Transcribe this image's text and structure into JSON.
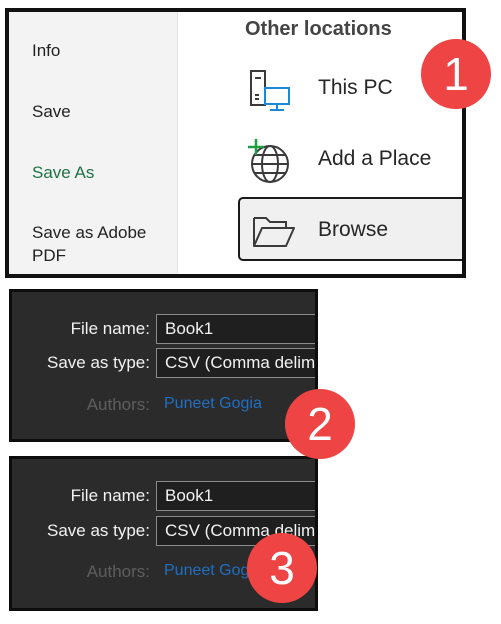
{
  "backstage": {
    "nav": [
      {
        "label": "Info",
        "active": false
      },
      {
        "label": "Save",
        "active": false
      },
      {
        "label": "Save As",
        "active": true
      },
      {
        "label": "Save as Adobe PDF",
        "active": false
      }
    ],
    "section_title": "Other locations",
    "locations": [
      {
        "label": "This PC",
        "icon": "this-pc-icon"
      },
      {
        "label": "Add a Place",
        "icon": "add-place-globe-icon"
      },
      {
        "label": "Browse",
        "icon": "folder-open-icon"
      }
    ]
  },
  "dialog2": {
    "file_name_label": "File name:",
    "file_name_value": "Book1",
    "save_type_label": "Save as type:",
    "save_type_value": "CSV (Comma delimited)",
    "authors_label": "Authors:",
    "authors_value": "Puneet Gogia"
  },
  "dialog3": {
    "file_name_label": "File name:",
    "file_name_value": "Book1",
    "save_type_label": "Save as type:",
    "save_type_value": "CSV (Comma delimited)",
    "authors_label": "Authors:",
    "authors_value": "Puneet Gogia"
  },
  "badges": [
    "1",
    "2",
    "3"
  ],
  "colors": {
    "accent_green": "#1e7145",
    "badge_red": "#ef4444",
    "link_blue": "#1f6fc4",
    "pc_icon_blue": "#1e88d8",
    "plus_green": "#1e9e40"
  }
}
